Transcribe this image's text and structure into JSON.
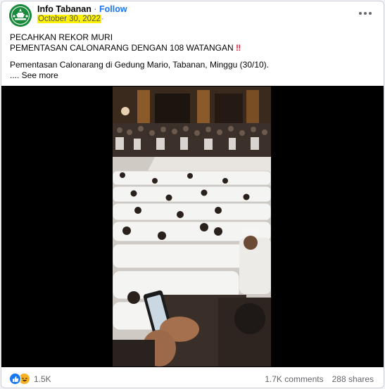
{
  "post": {
    "page_name": "Info Tabanan",
    "separator": "·",
    "follow_label": "Follow",
    "date": "October 30, 2022",
    "date_suffix": "·",
    "headline_1": "PECAHKAN REKOR MURI",
    "headline_2": "PEMENTASAN CALONARANG DENGAN 108 WATANGAN",
    "headline_emoji": "‼",
    "body": "Pementasan Calonarang di Gedung Mario, Tabanan, Minggu (30/10).",
    "see_more": ".... See more",
    "icons": {
      "avatar": "info-tabanan-logo",
      "menu": "more-horizontal-icon",
      "like": "like-reaction-icon",
      "haha": "haha-reaction-icon"
    }
  },
  "stats": {
    "reactions": "1.5K",
    "comments": "1.7K comments",
    "shares": "288 shares"
  },
  "colors": {
    "accent": "#1877f2",
    "date_highlight": "#fff200",
    "avatar_bg": "#1a8a3c"
  }
}
